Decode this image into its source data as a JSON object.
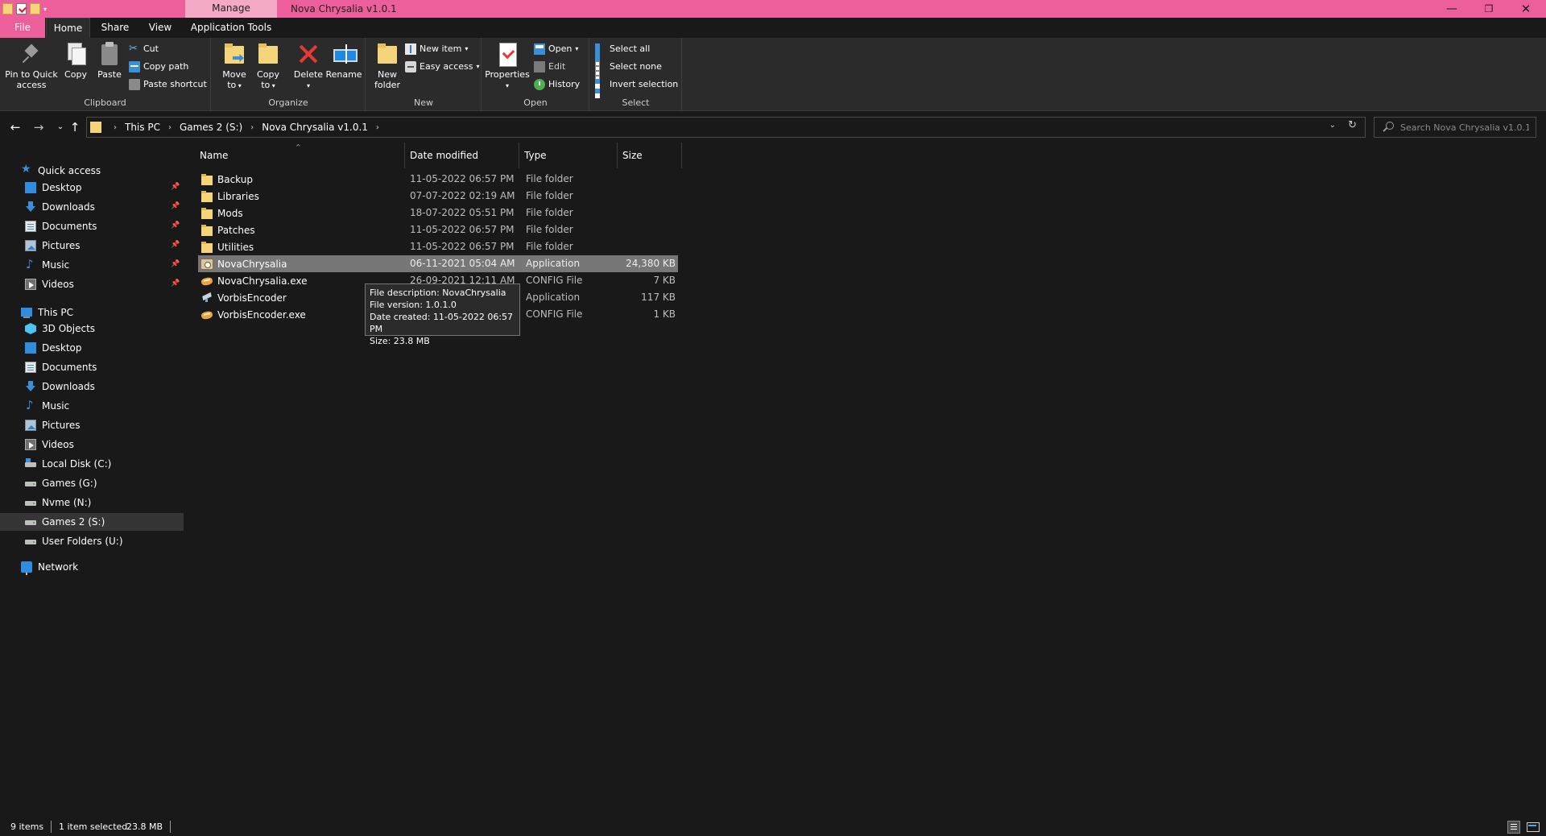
{
  "titlebar": {
    "manage_tab": "Manage",
    "title": "Nova Chrysalia v1.0.1",
    "minimize_glyph": "—",
    "maximize_glyph": "❐",
    "close_glyph": "✕"
  },
  "ribbon_tabs": {
    "file": "File",
    "home": "Home",
    "share": "Share",
    "view": "View",
    "app_tools": "Application Tools",
    "collapse_glyph": "^",
    "help_glyph": "?"
  },
  "ribbon": {
    "clipboard": {
      "label": "Clipboard",
      "pin_line1": "Pin to Quick",
      "pin_line2": "access",
      "copy": "Copy",
      "paste": "Paste",
      "cut": "Cut",
      "copy_path": "Copy path",
      "paste_shortcut": "Paste shortcut"
    },
    "organize": {
      "label": "Organize",
      "move_line1": "Move",
      "move_line2": "to",
      "copy_line1": "Copy",
      "copy_line2": "to",
      "delete": "Delete",
      "rename": "Rename"
    },
    "new": {
      "label": "New",
      "new_folder_line1": "New",
      "new_folder_line2": "folder",
      "new_item": "New item",
      "easy_access": "Easy access"
    },
    "open": {
      "label": "Open",
      "properties": "Properties",
      "open": "Open",
      "edit": "Edit",
      "history": "History"
    },
    "select": {
      "label": "Select",
      "select_all": "Select all",
      "select_none": "Select none",
      "invert_selection": "Invert selection"
    }
  },
  "address": {
    "back_glyph": "←",
    "forward_glyph": "→",
    "recent_glyph": "⌄",
    "up_glyph": "↑",
    "crumbs": [
      "This PC",
      "Games 2 (S:)",
      "Nova Chrysalia v1.0.1"
    ],
    "crumb_sep": "›",
    "dropdown_glyph": "⌄",
    "refresh_glyph": "↻",
    "search_placeholder": "Search Nova Chrysalia v1.0.1"
  },
  "navpane": {
    "quick_access": "Quick access",
    "quick_items": [
      "Desktop",
      "Downloads",
      "Documents",
      "Pictures",
      "Music",
      "Videos"
    ],
    "this_pc": "This PC",
    "pc_items": [
      "3D Objects",
      "Desktop",
      "Documents",
      "Downloads",
      "Music",
      "Pictures",
      "Videos",
      "Local Disk (C:)",
      "Games (G:)",
      "Nvme (N:)",
      "Games 2 (S:)",
      "User Folders (U:)"
    ],
    "network": "Network",
    "selected": "Games 2 (S:)"
  },
  "columns": {
    "name": "Name",
    "date": "Date modified",
    "type": "Type",
    "size": "Size"
  },
  "files": [
    {
      "name": "Backup",
      "date": "11-05-2022 06:57 PM",
      "type": "File folder",
      "size": "",
      "icon": "folder-icon"
    },
    {
      "name": "Libraries",
      "date": "07-07-2022 02:19 AM",
      "type": "File folder",
      "size": "",
      "icon": "folder-icon"
    },
    {
      "name": "Mods",
      "date": "18-07-2022 05:51 PM",
      "type": "File folder",
      "size": "",
      "icon": "folder-icon"
    },
    {
      "name": "Patches",
      "date": "11-05-2022 06:57 PM",
      "type": "File folder",
      "size": "",
      "icon": "folder-icon"
    },
    {
      "name": "Utilities",
      "date": "11-05-2022 06:57 PM",
      "type": "File folder",
      "size": "",
      "icon": "folder-icon"
    },
    {
      "name": "NovaChrysalia",
      "date": "06-11-2021 05:04 AM",
      "type": "Application",
      "size": "24,380 KB",
      "icon": "app-icon"
    },
    {
      "name": "NovaChrysalia.exe",
      "date": "26-09-2021 12:11 AM",
      "type": "CONFIG File",
      "size": "7 KB",
      "icon": "config-file-icon"
    },
    {
      "name": "VorbisEncoder",
      "date": "",
      "type": "Application",
      "size": "117 KB",
      "icon": "vorbis-app-icon"
    },
    {
      "name": "VorbisEncoder.exe",
      "date": "",
      "type": "CONFIG File",
      "size": "1 KB",
      "icon": "config-file-icon"
    }
  ],
  "tooltip": {
    "line1": "File description: NovaChrysalia",
    "line2": "File version: 1.0.1.0",
    "line3": "Date created: 11-05-2022 06:57 PM",
    "line4": "Size: 23.8 MB"
  },
  "status": {
    "item_count": "9 items",
    "selection": "1 item selected",
    "selection_size": "23.8 MB"
  }
}
